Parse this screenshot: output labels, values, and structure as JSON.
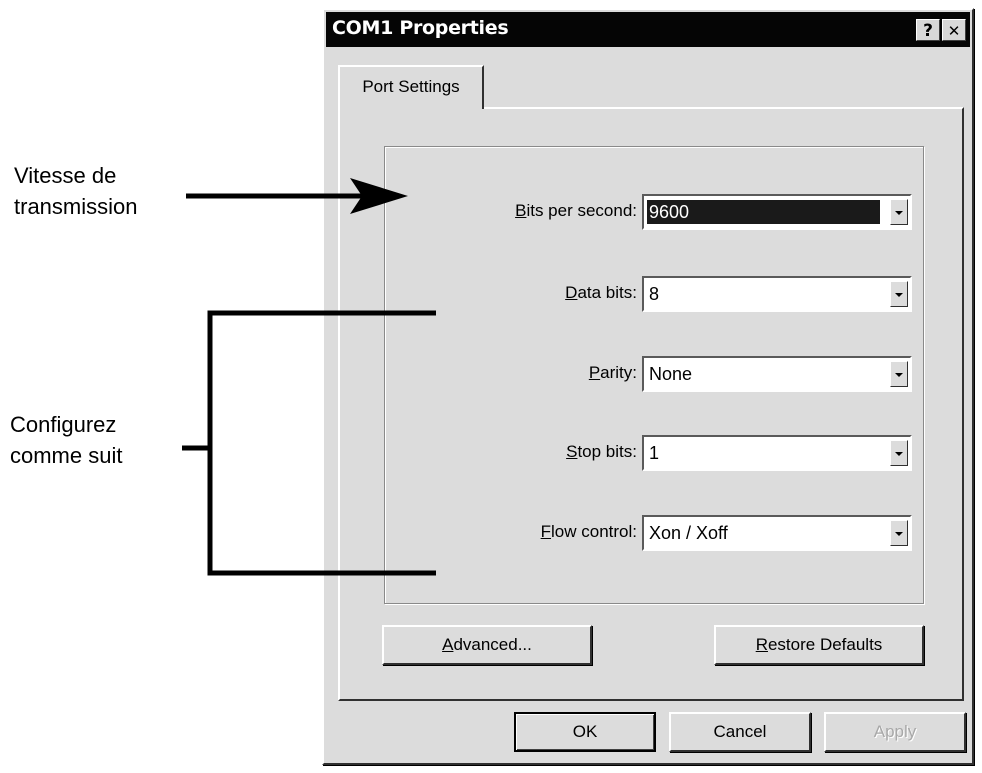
{
  "annotations": {
    "speed": {
      "line1": "Vitesse de",
      "line2": "transmission"
    },
    "configure": {
      "line1": "Configurez",
      "line2": "comme suit"
    }
  },
  "window": {
    "title": "COM1 Properties",
    "help_label": "?",
    "close_label": "✕"
  },
  "tabs": [
    {
      "label": "Port Settings",
      "active": true
    }
  ],
  "fields": [
    {
      "key": "B",
      "label_rest": "its per second:",
      "value": "9600",
      "selected": true
    },
    {
      "key": "D",
      "label_rest": "ata bits:",
      "value": "8"
    },
    {
      "key": "P",
      "label_rest": "arity:",
      "value": "None"
    },
    {
      "key": "S",
      "label_rest": "top bits:",
      "value": "1"
    },
    {
      "key": "F",
      "label_rest": "low control:",
      "value": "Xon / Xoff"
    }
  ],
  "buttons": {
    "advanced": {
      "key": "A",
      "rest": "dvanced..."
    },
    "restore": {
      "key": "R",
      "rest": "estore Defaults"
    },
    "ok": "OK",
    "cancel": "Cancel",
    "apply": "Apply"
  },
  "colors": {
    "titlebar": "#050505",
    "dialog": "#dcdcdc",
    "selection": "#1a1a1a"
  }
}
